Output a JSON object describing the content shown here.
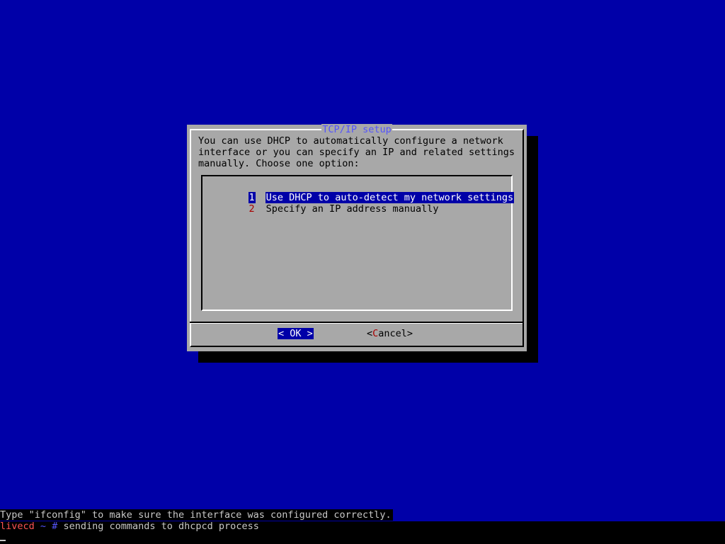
{
  "dialog": {
    "title": "TCP/IP setup",
    "description": "You can use DHCP to automatically configure a network\ninterface or you can specify an IP and related settings\nmanually. Choose one option:",
    "options": [
      {
        "tag": "1",
        "label": "Use DHCP to auto-detect my network settings",
        "selected": true
      },
      {
        "tag": "2",
        "label": "Specify an IP address manually",
        "selected": false
      }
    ],
    "buttons": {
      "ok": "< OK >",
      "cancel_open": "<",
      "cancel_hot": "C",
      "cancel_rest": "ancel",
      "cancel_close": ">"
    }
  },
  "terminal": {
    "line1": "Type \"ifconfig\" to make sure the interface was configured correctly.",
    "prompt_host": "livecd",
    "prompt_path": "~",
    "prompt_hash": "#",
    "command": "sending commands to dhcpcd process"
  },
  "colors": {
    "background": "#0000a8",
    "dialog": "#a8a8a8",
    "title": "#5454fc",
    "highlight": "#0000a8",
    "hotkey": "#a80000"
  }
}
